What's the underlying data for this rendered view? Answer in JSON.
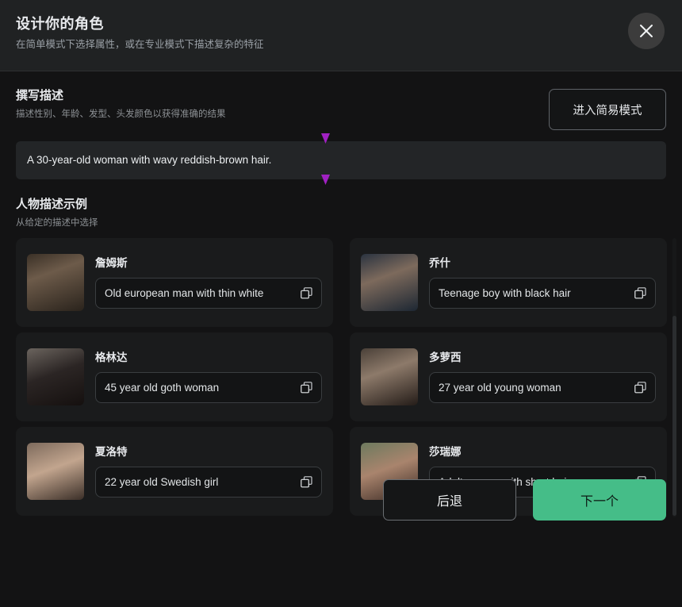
{
  "header": {
    "title": "设计你的角色",
    "subtitle": "在简单模式下选择属性，或在专业模式下描述复杂的特征",
    "close_icon": "close-icon"
  },
  "compose": {
    "title": "撰写描述",
    "subtitle": "描述性别、年龄、发型、头发颜色以获得准确的结果",
    "mode_button": "进入简易模式",
    "prompt_value": "A 30-year-old woman with wavy reddish-brown hair.",
    "prompt_placeholder": "",
    "selection_handle_color": "#a021c2"
  },
  "examples": {
    "title": "人物描述示例",
    "subtitle": "从给定的描述中选择",
    "copy_icon": "copy-icon",
    "cards": [
      {
        "name": "詹姆斯",
        "description": "Old european man with thin white"
      },
      {
        "name": "乔什",
        "description": "Teenage boy with black hair"
      },
      {
        "name": "格林达",
        "description": "45 year old goth woman"
      },
      {
        "name": "多萝西",
        "description": "27 year old young woman"
      },
      {
        "name": "夏洛特",
        "description": "22 year old Swedish girl"
      },
      {
        "name": "莎瑞娜",
        "description": "Adult woman with short hair"
      }
    ]
  },
  "footer": {
    "back_label": "后退",
    "next_label": "下一个",
    "next_color": "#45bd88"
  }
}
